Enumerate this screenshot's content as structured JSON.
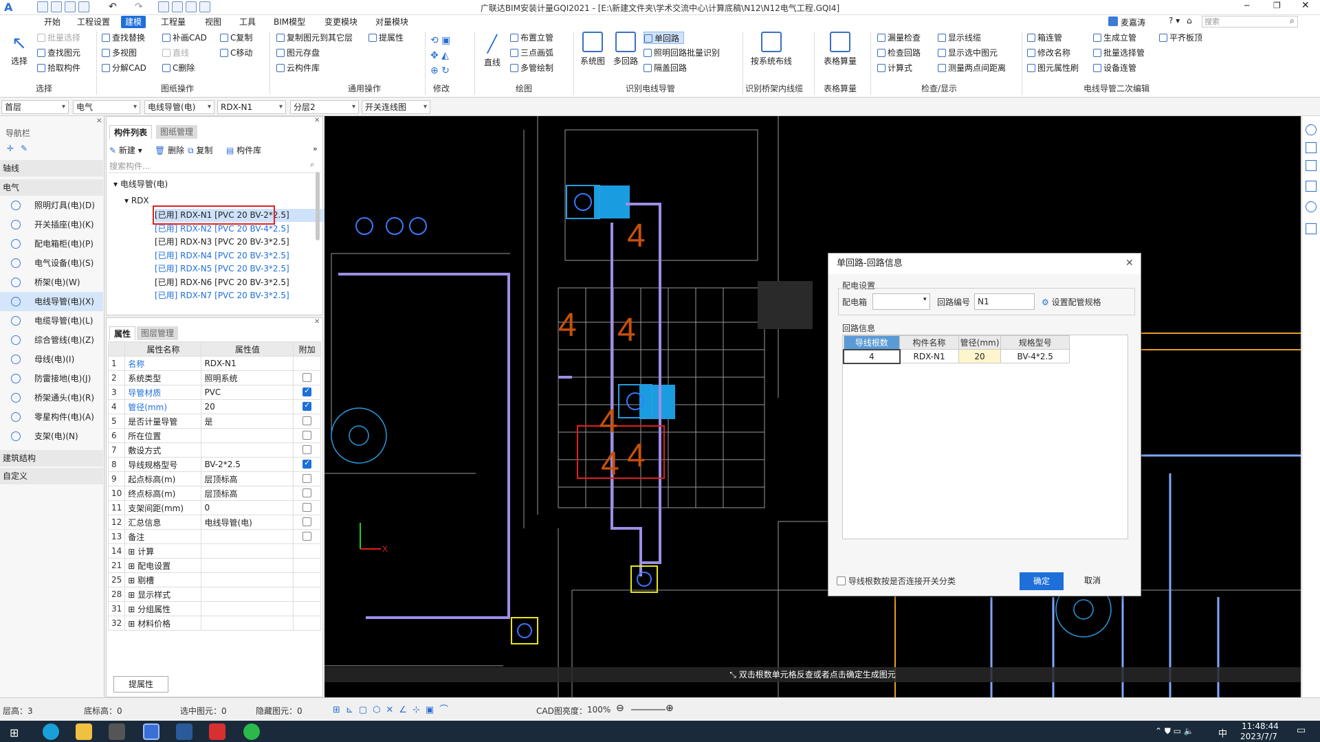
{
  "titlebar": {
    "title": "广联达BIM安装计量GQI2021 - [E:\\新建文件夹\\学术交流中心\\计算底稿\\N12\\N12电气工程.GQI4]",
    "user": "麦嘉涛",
    "search_placeholder": "搜索"
  },
  "menu": [
    "开始",
    "工程设置",
    "建模",
    "工程量",
    "视图",
    "工具",
    "BIM模型",
    "变更模块",
    "对量模块"
  ],
  "ribbon": {
    "select": {
      "label": "选择",
      "group": "选择",
      "items": [
        "批量选择",
        "查找图元",
        "拾取构件"
      ]
    },
    "drawing": {
      "group": "图纸操作",
      "items": [
        "查找替换",
        "多视图",
        "分解CAD",
        "补画CAD",
        "直线",
        "C删除",
        "C复制",
        "C移动"
      ]
    },
    "common": {
      "group": "通用操作",
      "items": [
        "复制图元到其它层",
        "图元存盘",
        "云构件库",
        "提属性"
      ]
    },
    "modify": {
      "group": "修改"
    },
    "draw": {
      "group": "绘图",
      "line": "直线",
      "items": [
        "布置立管",
        "三点画弧",
        "多管绘制"
      ]
    },
    "identify": {
      "group": "识别电线导管",
      "system": "系统图",
      "multi": "多回路",
      "items": [
        "单回路",
        "照明回路批量识别",
        "隔盖回路"
      ]
    },
    "bridge": {
      "group": "识别桥架内线缆",
      "label": "按系统布线"
    },
    "table": {
      "group": "表格算量",
      "label": "表格算量"
    },
    "check": {
      "group": "检查/显示",
      "items": [
        "漏量检查",
        "检查回路",
        "计算式",
        "显示线缆",
        "显示选中图元",
        "测量两点间距离"
      ]
    },
    "edit2": {
      "group": "电线导管二次编辑",
      "items": [
        "箱连管",
        "修改名称",
        "图元属性刷",
        "生成立管",
        "批量选择管",
        "设备连管",
        "平齐板顶"
      ]
    }
  },
  "filters": [
    "首层",
    "电气",
    "电线导管(电)",
    "RDX-N1",
    "分层2",
    "开关连线图"
  ],
  "nav": {
    "title": "导航栏",
    "sections": [
      "轴线",
      "电气",
      "建筑结构",
      "自定义"
    ],
    "items": [
      "照明灯具(电)(D)",
      "开关插座(电)(K)",
      "配电箱柜(电)(P)",
      "电气设备(电)(S)",
      "桥架(电)(W)",
      "电线导管(电)(X)",
      "电缆导管(电)(L)",
      "综合管线(电)(Z)",
      "母线(电)(I)",
      "防雷接地(电)(J)",
      "桥架通头(电)(R)",
      "零星构件(电)(A)",
      "支架(电)(N)"
    ]
  },
  "comp": {
    "tabs": [
      "构件列表",
      "图纸管理"
    ],
    "toolbar": [
      "新建",
      "删除",
      "复制",
      "构件库"
    ],
    "search_placeholder": "搜索构件...",
    "root": "电线导管(电)",
    "group": "RDX",
    "items": [
      "[已用] RDX-N1 [PVC 20 BV-2*2.5]",
      "[已用] RDX-N2 [PVC 20 BV-4*2.5]",
      "[已用] RDX-N3 [PVC 20 BV-3*2.5]",
      "[已用] RDX-N4 [PVC 20 BV-3*2.5]",
      "[已用] RDX-N5 [PVC 20 BV-3*2.5]",
      "[已用] RDX-N6 [PVC 20 BV-3*2.5]",
      "[已用] RDX-N7 [PVC 20 BV-3*2.5]"
    ]
  },
  "props": {
    "tabs": [
      "属性",
      "图层管理"
    ],
    "headers": [
      "属性名称",
      "属性值",
      "附加"
    ],
    "rows": [
      {
        "n": "1",
        "k": "名称",
        "v": "RDX-N1",
        "blue": true,
        "cb": null
      },
      {
        "n": "2",
        "k": "系统类型",
        "v": "照明系统",
        "blue": false,
        "cb": false
      },
      {
        "n": "3",
        "k": "导管材质",
        "v": "PVC",
        "blue": true,
        "cb": true
      },
      {
        "n": "4",
        "k": "管径(mm)",
        "v": "20",
        "blue": true,
        "cb": true
      },
      {
        "n": "5",
        "k": "是否计量导管",
        "v": "是",
        "blue": false,
        "cb": false
      },
      {
        "n": "6",
        "k": "所在位置",
        "v": "",
        "blue": false,
        "cb": false
      },
      {
        "n": "7",
        "k": "敷设方式",
        "v": "",
        "blue": false,
        "cb": false
      },
      {
        "n": "8",
        "k": "导线规格型号",
        "v": "BV-2*2.5",
        "blue": false,
        "cb": true
      },
      {
        "n": "9",
        "k": "起点标高(m)",
        "v": "层顶标高",
        "blue": false,
        "cb": false
      },
      {
        "n": "10",
        "k": "终点标高(m)",
        "v": "层顶标高",
        "blue": false,
        "cb": false
      },
      {
        "n": "11",
        "k": "支架间距(mm)",
        "v": "0",
        "blue": false,
        "cb": false
      },
      {
        "n": "12",
        "k": "汇总信息",
        "v": "电线导管(电)",
        "blue": false,
        "cb": false
      },
      {
        "n": "13",
        "k": "备注",
        "v": "",
        "blue": false,
        "cb": false
      },
      {
        "n": "14",
        "k": "⊞ 计算",
        "v": "",
        "blue": false,
        "cb": null
      },
      {
        "n": "21",
        "k": "⊞ 配电设置",
        "v": "",
        "blue": false,
        "cb": null
      },
      {
        "n": "25",
        "k": "⊞ 剔槽",
        "v": "",
        "blue": false,
        "cb": null
      },
      {
        "n": "28",
        "k": "⊞ 显示样式",
        "v": "",
        "blue": false,
        "cb": null
      },
      {
        "n": "31",
        "k": "⊞ 分组属性",
        "v": "",
        "blue": false,
        "cb": null
      },
      {
        "n": "32",
        "k": "⊞ 材料价格",
        "v": "",
        "blue": false,
        "cb": null
      }
    ],
    "button": "提属性"
  },
  "canvas": {
    "hint": "双击根数单元格反查或者点击确定生成图元",
    "numbers": [
      "4",
      "4",
      "4",
      "4",
      "4",
      "4"
    ]
  },
  "dialog": {
    "title": "单回路-回路信息",
    "sec1": "配电设置",
    "box_label": "配电箱",
    "box_value": "",
    "circuit_label": "回路编号",
    "circuit_value": "N1",
    "spec_btn": "设置配管规格",
    "sec2": "回路信息",
    "headers": [
      "导线根数",
      "构件名称",
      "管径(mm)",
      "规格型号"
    ],
    "row": [
      "4",
      "RDX-N1",
      "20",
      "BV-4*2.5"
    ],
    "check": "导线根数按是否连接开关分类",
    "ok": "确定",
    "cancel": "取消"
  },
  "status": {
    "floor": "层高：3",
    "base": "底标高：0",
    "selected": "选中图元：0",
    "hidden": "隐藏图元：0",
    "cad": "CAD图亮度：",
    "cad_val": "100%"
  },
  "taskbar": {
    "time": "11:48:44",
    "date": "2023/7/7",
    "ime": "中"
  }
}
